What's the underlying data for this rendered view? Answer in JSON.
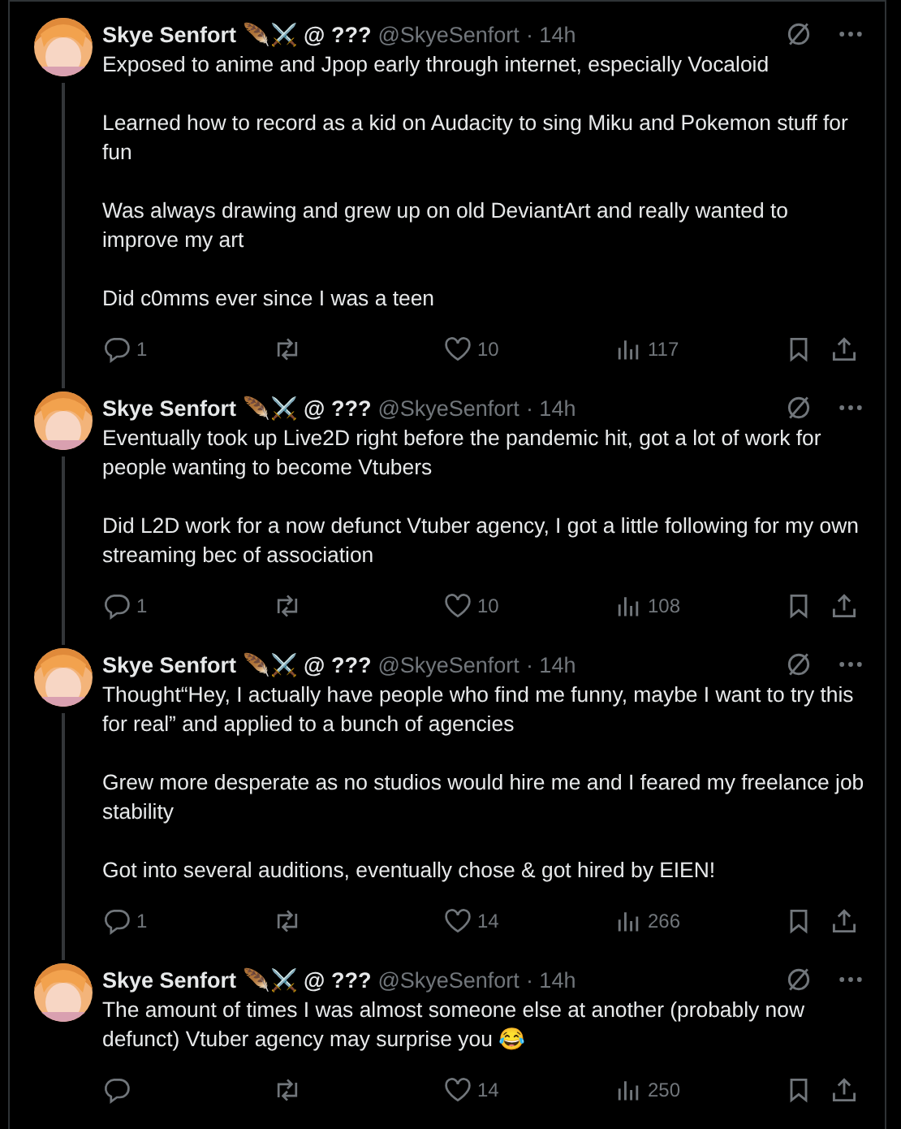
{
  "tweets": [
    {
      "author": "Skye Senfort 🪶⚔️ @ ???",
      "handle": "@SkyeSenfort",
      "time": "· 14h",
      "thread_line": true,
      "paragraphs": [
        "Exposed to anime and Jpop early through internet, especially Vocaloid",
        "Learned how to record as a kid on Audacity to sing Miku and Pokemon stuff for fun",
        "Was always drawing and grew up on old DeviantArt and really wanted to improve my art",
        "Did c0mms ever since I was a teen"
      ],
      "replies": "1",
      "likes": "10",
      "views": "117"
    },
    {
      "author": "Skye Senfort 🪶⚔️ @ ???",
      "handle": "@SkyeSenfort",
      "time": "· 14h",
      "thread_line": true,
      "paragraphs": [
        "Eventually took up Live2D right before the pandemic hit, got a lot of work for people wanting to become Vtubers",
        "Did L2D work for a now defunct Vtuber agency, I got a little following for my own streaming bec of association"
      ],
      "replies": "1",
      "likes": "10",
      "views": "108"
    },
    {
      "author": "Skye Senfort 🪶⚔️ @ ???",
      "handle": "@SkyeSenfort",
      "time": "· 14h",
      "thread_line": true,
      "paragraphs": [
        "Thought“Hey, I actually have people who find me funny, maybe I want to try this for real” and applied to a bunch of agencies",
        "Grew more desperate as no studios would hire me and I feared my freelance job stability",
        "Got into several auditions, eventually chose & got hired by EIEN!"
      ],
      "replies": "1",
      "likes": "14",
      "views": "266"
    },
    {
      "author": "Skye Senfort 🪶⚔️ @ ???",
      "handle": "@SkyeSenfort",
      "time": "· 14h",
      "thread_line": false,
      "paragraphs": [
        "The amount of times I was almost someone else at another (probably now defunct) Vtuber agency may surprise you 😂"
      ],
      "likes": "14",
      "views": "250"
    }
  ]
}
